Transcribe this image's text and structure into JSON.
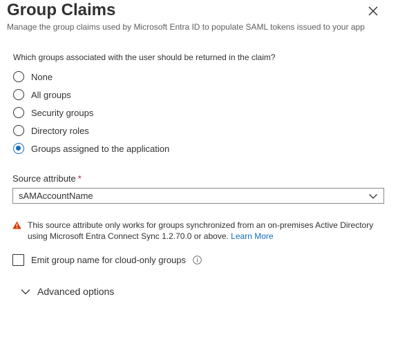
{
  "panel": {
    "title": "Group Claims",
    "subtitle": "Manage the group claims used by Microsoft Entra ID to populate SAML tokens issued to your app",
    "close_icon": "close-icon"
  },
  "groups_question": {
    "label": "Which groups associated with the user should be returned in the claim?",
    "options": [
      {
        "label": "None",
        "selected": false
      },
      {
        "label": "All groups",
        "selected": false
      },
      {
        "label": "Security groups",
        "selected": false
      },
      {
        "label": "Directory roles",
        "selected": false
      },
      {
        "label": "Groups assigned to the application",
        "selected": true
      }
    ]
  },
  "source_attribute": {
    "label": "Source attribute",
    "required_marker": "*",
    "value": "sAMAccountName",
    "chevron_icon": "chevron-down-icon"
  },
  "warning": {
    "icon": "warning-icon",
    "text": "This source attribute only works for groups synchronized from an on-premises Active Directory using Microsoft Entra Connect Sync 1.2.70.0 or above.",
    "link_text": "Learn More",
    "color": "#d83b01"
  },
  "cloud_only": {
    "label": "Emit group name for cloud-only groups",
    "checked": false,
    "info_icon": "info-icon"
  },
  "advanced": {
    "label": "Advanced options",
    "expanded": false,
    "chevron_icon": "chevron-down-icon"
  },
  "colors": {
    "accent": "#0f6cbd",
    "text": "#323130",
    "required": "#a4262c"
  }
}
